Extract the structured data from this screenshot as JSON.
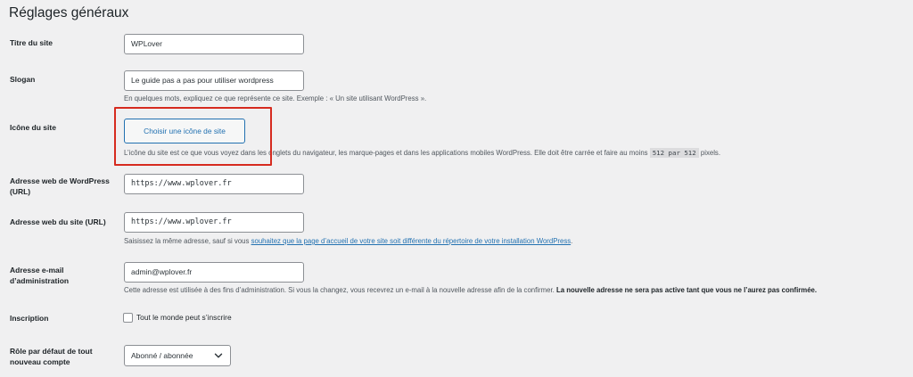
{
  "page": {
    "title": "Réglages généraux"
  },
  "site_title": {
    "label": "Titre du site",
    "value": "WPLover"
  },
  "tagline": {
    "label": "Slogan",
    "value": "Le guide pas a pas pour utiliser wordpress",
    "description": "En quelques mots, expliquez ce que représente ce site. Exemple : « Un site utilisant WordPress »."
  },
  "site_icon": {
    "label": "Icône du site",
    "button_label": "Choisir une icône de site",
    "description_before": "L’icône du site est ce que vous voyez dans les onglets du navigateur, les marque-pages et dans les applications mobiles WordPress. Elle doit être carrée et faire au moins",
    "size_w": "512",
    "size_sep": "par",
    "size_h": "512",
    "description_after": "pixels.",
    "highlight_color": "#d62b1f"
  },
  "wp_address": {
    "label": "Adresse web de WordPress (URL)",
    "value": "https://www.wplover.fr"
  },
  "site_address": {
    "label": "Adresse web du site (URL)",
    "value": "https://www.wplover.fr",
    "description_before": "Saisissez la même adresse, sauf si vous",
    "link_text": "souhaitez que la page d’accueil de votre site soit différente du répertoire de votre installation WordPress",
    "description_after": "."
  },
  "admin_email": {
    "label": "Adresse e-mail d’administration",
    "value": "admin@wplover.fr",
    "description": "Cette adresse est utilisée à des fins d’administration. Si vous la changez, vous recevrez un e-mail à la nouvelle adresse afin de la confirmer.",
    "description_strong": "La nouvelle adresse ne sera pas active tant que vous ne l’aurez pas confirmée."
  },
  "membership": {
    "label": "Inscription",
    "checkbox_label": "Tout le monde peut s’inscrire",
    "checked": false
  },
  "default_role": {
    "label": "Rôle par défaut de tout nouveau compte",
    "selected": "Abonné / abonnée"
  },
  "colors": {
    "accent": "#2271b1",
    "background": "#f0f0f1"
  }
}
